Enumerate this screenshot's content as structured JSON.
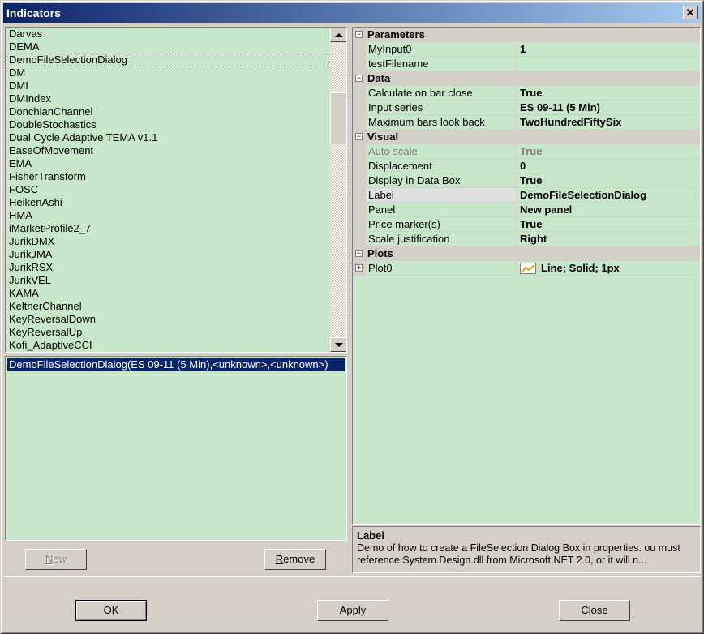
{
  "window": {
    "title": "Indicators",
    "close_glyph": "✕"
  },
  "indicator_list": {
    "items": [
      "Darvas",
      "DEMA",
      "DemoFileSelectionDialog",
      "DM",
      "DMI",
      "DMIndex",
      "DonchianChannel",
      "DoubleStochastics",
      "Dual Cycle Adaptive TEMA v1.1",
      "EaseOfMovement",
      "EMA",
      "FisherTransform",
      "FOSC",
      "HeikenAshi",
      "HMA",
      "iMarketProfile2_7",
      "JurikDMX",
      "JurikJMA",
      "JurikRSX",
      "JurikVEL",
      "KAMA",
      "KeltnerChannel",
      "KeyReversalDown",
      "KeyReversalUp",
      "Kofi_AdaptiveCCI"
    ],
    "focused_item": "DemoFileSelectionDialog"
  },
  "applied_list": {
    "items": [
      "DemoFileSelectionDialog(ES 09-11 (5 Min),<unknown>,<unknown>)"
    ]
  },
  "buttons": {
    "new": {
      "accel": "N",
      "rest": "ew"
    },
    "remove": {
      "accel": "R",
      "rest": "emove"
    },
    "ok": "OK",
    "apply": "Apply",
    "close": "Close"
  },
  "property_grid": {
    "categories": [
      {
        "name": "Parameters",
        "toggle": "−",
        "props": [
          {
            "name": "MyInput0",
            "value": "1"
          },
          {
            "name": "testFilename",
            "value": ""
          }
        ]
      },
      {
        "name": "Data",
        "toggle": "−",
        "props": [
          {
            "name": "Calculate on bar close",
            "value": "True"
          },
          {
            "name": "Input series",
            "value": "ES 09-11 (5 Min)"
          },
          {
            "name": "Maximum bars look back",
            "value": "TwoHundredFiftySix"
          }
        ]
      },
      {
        "name": "Visual",
        "toggle": "−",
        "props": [
          {
            "name": "Auto scale",
            "value": "True",
            "disabled": true
          },
          {
            "name": "Displacement",
            "value": "0"
          },
          {
            "name": "Display in Data Box",
            "value": "True"
          },
          {
            "name": "Label",
            "value": "DemoFileSelectionDialog",
            "selected": true
          },
          {
            "name": "Panel",
            "value": "New panel"
          },
          {
            "name": "Price marker(s)",
            "value": "True"
          },
          {
            "name": "Scale justification",
            "value": "Right"
          }
        ]
      },
      {
        "name": "Plots",
        "toggle": "−",
        "props": [
          {
            "name": "Plot0",
            "value": "Line; Solid; 1px",
            "expandable": true,
            "swatch_icon": "line-chart-swatch-icon",
            "swatch_color": "#f0a000"
          }
        ]
      }
    ]
  },
  "description": {
    "title": "Label",
    "text": "Demo of how to create a FileSelection Dialog Box in properties. ou must reference System.Design.dll from Microsoft.NET 2.0, or it will n..."
  }
}
